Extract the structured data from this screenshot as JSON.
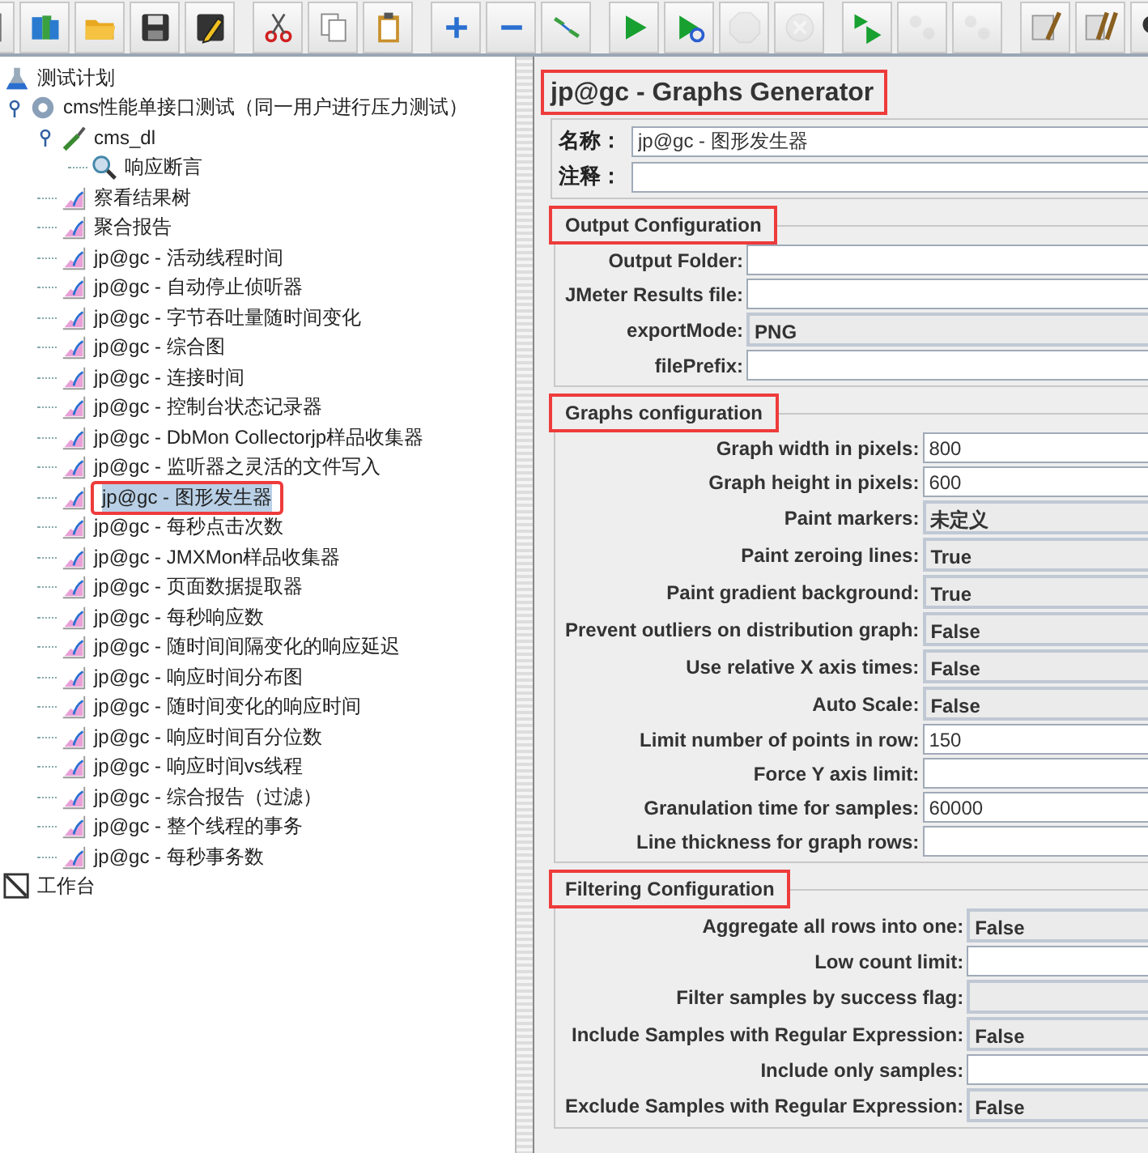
{
  "toolbar": [
    {
      "kind": "new"
    },
    {
      "kind": "templates",
      "disabled": false
    },
    {
      "kind": "open",
      "disabled": false
    },
    {
      "kind": "save",
      "disabled": false
    },
    {
      "kind": "save-as",
      "disabled": false
    },
    {
      "kind": "cut",
      "disabled": false
    },
    {
      "kind": "copy",
      "disabled": false
    },
    {
      "kind": "paste",
      "disabled": false
    },
    {
      "kind": "expand",
      "disabled": false
    },
    {
      "kind": "collapse",
      "disabled": false
    },
    {
      "kind": "toggle",
      "disabled": false
    },
    {
      "kind": "start",
      "disabled": false
    },
    {
      "kind": "start-no-timers",
      "disabled": false
    },
    {
      "kind": "stop",
      "disabled": true
    },
    {
      "kind": "shutdown",
      "disabled": true
    },
    {
      "kind": "remote-start",
      "disabled": false
    },
    {
      "kind": "remote-stop",
      "disabled": true
    },
    {
      "kind": "remote-shutdown",
      "disabled": true
    },
    {
      "kind": "clear",
      "disabled": false
    },
    {
      "kind": "clear-all",
      "disabled": false
    },
    {
      "kind": "search"
    }
  ],
  "tree": [
    {
      "label": "测试计划",
      "kind": "plan",
      "selected": false,
      "highlighted": false,
      "children": [
        {
          "label": "cms性能单接口测试（同一用户进行压力测试）",
          "kind": "thread-group",
          "selected": false,
          "highlighted": false,
          "expanded": true,
          "children": [
            {
              "label": "cms_dl",
              "kind": "sampler",
              "selected": false,
              "highlighted": false,
              "expanded": true,
              "children": [
                {
                  "label": "响应断言",
                  "kind": "assertion",
                  "selected": false,
                  "highlighted": false
                }
              ]
            },
            {
              "label": "察看结果树",
              "kind": "listener",
              "selected": false,
              "highlighted": false
            },
            {
              "label": "聚合报告",
              "kind": "listener",
              "selected": false,
              "highlighted": false
            },
            {
              "label": "jp@gc - 活动线程时间",
              "kind": "listener",
              "selected": false,
              "highlighted": false
            },
            {
              "label": "jp@gc - 自动停止侦听器",
              "kind": "listener",
              "selected": false,
              "highlighted": false
            },
            {
              "label": "jp@gc - 字节吞吐量随时间变化",
              "kind": "listener",
              "selected": false,
              "highlighted": false
            },
            {
              "label": "jp@gc - 综合图",
              "kind": "listener",
              "selected": false,
              "highlighted": false
            },
            {
              "label": "jp@gc - 连接时间",
              "kind": "listener",
              "selected": false,
              "highlighted": false
            },
            {
              "label": "jp@gc - 控制台状态记录器",
              "kind": "listener",
              "selected": false,
              "highlighted": false
            },
            {
              "label": "jp@gc - DbMon Collectorjp样品收集器",
              "kind": "listener",
              "selected": false,
              "highlighted": false
            },
            {
              "label": "jp@gc - 监听器之灵活的文件写入",
              "kind": "listener",
              "selected": false,
              "highlighted": false
            },
            {
              "label": "jp@gc - 图形发生器",
              "kind": "listener",
              "selected": true,
              "highlighted": true
            },
            {
              "label": "jp@gc - 每秒点击次数",
              "kind": "listener",
              "selected": false,
              "highlighted": false
            },
            {
              "label": "jp@gc - JMXMon样品收集器",
              "kind": "listener",
              "selected": false,
              "highlighted": false
            },
            {
              "label": "jp@gc - 页面数据提取器",
              "kind": "listener",
              "selected": false,
              "highlighted": false
            },
            {
              "label": "jp@gc - 每秒响应数",
              "kind": "listener",
              "selected": false,
              "highlighted": false
            },
            {
              "label": "jp@gc - 随时间间隔变化的响应延迟",
              "kind": "listener",
              "selected": false,
              "highlighted": false
            },
            {
              "label": "jp@gc - 响应时间分布图",
              "kind": "listener",
              "selected": false,
              "highlighted": false
            },
            {
              "label": "jp@gc - 随时间变化的响应时间",
              "kind": "listener",
              "selected": false,
              "highlighted": false
            },
            {
              "label": "jp@gc - 响应时间百分位数",
              "kind": "listener",
              "selected": false,
              "highlighted": false
            },
            {
              "label": "jp@gc - 响应时间vs线程",
              "kind": "listener",
              "selected": false,
              "highlighted": false
            },
            {
              "label": "jp@gc - 综合报告（过滤）",
              "kind": "listener",
              "selected": false,
              "highlighted": false
            },
            {
              "label": "jp@gc - 整个线程的事务",
              "kind": "listener",
              "selected": false,
              "highlighted": false
            },
            {
              "label": "jp@gc - 每秒事务数",
              "kind": "listener",
              "selected": false,
              "highlighted": false
            }
          ]
        }
      ]
    },
    {
      "label": "工作台",
      "kind": "workbench",
      "selected": false,
      "highlighted": false
    }
  ],
  "panel": {
    "title": "jp@gc - Graphs Generator",
    "title_highlighted": true,
    "name_label": "名称：",
    "name_value": "jp@gc - 图形发生器",
    "comment_label": "注释：",
    "groups": [
      {
        "legend": "Output Configuration",
        "highlighted": true,
        "rows": [
          {
            "label": "Output Folder:",
            "kind": "text"
          },
          {
            "label": "JMeter Results file:",
            "kind": "text"
          },
          {
            "label": "exportMode:",
            "kind": "select",
            "value": "PNG"
          },
          {
            "label": "filePrefix:",
            "kind": "text"
          }
        ]
      },
      {
        "legend": "Graphs configuration",
        "highlighted": true,
        "rows": [
          {
            "label": "Graph width in pixels:",
            "kind": "text",
            "value": "800"
          },
          {
            "label": "Graph height in pixels:",
            "kind": "text",
            "value": "600"
          },
          {
            "label": "Paint markers:",
            "kind": "select",
            "value": "未定义"
          },
          {
            "label": "Paint zeroing lines:",
            "kind": "select",
            "value": "True"
          },
          {
            "label": "Paint gradient background:",
            "kind": "select",
            "value": "True"
          },
          {
            "label": "Prevent outliers on distribution graph:",
            "kind": "select",
            "value": "False"
          },
          {
            "label": "Use relative X axis times:",
            "kind": "select",
            "value": "False"
          },
          {
            "label": "Auto Scale:",
            "kind": "select",
            "value": "False"
          },
          {
            "label": "Limit number of points in row:",
            "kind": "text",
            "value": "150"
          },
          {
            "label": "Force Y axis limit:",
            "kind": "text"
          },
          {
            "label": "Granulation time for samples:",
            "kind": "text",
            "value": "60000"
          },
          {
            "label": "Line thickness for graph rows:",
            "kind": "text"
          }
        ]
      },
      {
        "legend": "Filtering Configuration",
        "highlighted": true,
        "rows": [
          {
            "label": "Aggregate all rows into one:",
            "kind": "select",
            "value": "False"
          },
          {
            "label": "Low count limit:",
            "kind": "text"
          },
          {
            "label": "Filter samples by success flag:",
            "kind": "select"
          },
          {
            "label": "Include Samples with Regular Expression:",
            "kind": "select",
            "value": "False"
          },
          {
            "label": "Include only samples:",
            "kind": "text"
          },
          {
            "label": "Exclude Samples with Regular Expression:",
            "kind": "select",
            "value": "False"
          }
        ]
      }
    ]
  }
}
